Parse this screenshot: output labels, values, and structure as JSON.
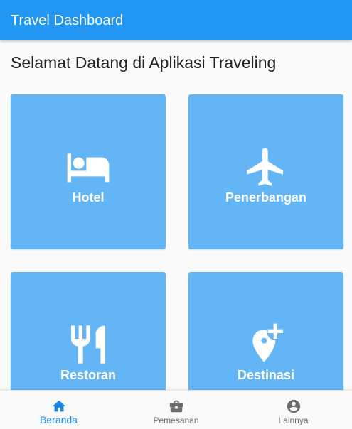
{
  "appbar": {
    "title": "Travel Dashboard"
  },
  "main": {
    "heading": "Selamat Datang di Aplikasi Traveling",
    "cards": [
      {
        "label": "Hotel",
        "icon": "hotel-bed-icon"
      },
      {
        "label": "Penerbangan",
        "icon": "airplane-icon"
      },
      {
        "label": "Restoran",
        "icon": "fork-knife-icon"
      },
      {
        "label": "Destinasi",
        "icon": "add-location-icon"
      }
    ],
    "card_color": "#64b5f6"
  },
  "bottom_nav": {
    "items": [
      {
        "label": "Beranda",
        "icon": "home-icon",
        "active": true
      },
      {
        "label": "Pemesanan",
        "icon": "briefcase-icon",
        "active": false
      },
      {
        "label": "Lainnya",
        "icon": "account-circle-icon",
        "active": false
      }
    ],
    "active_color": "#1e88e5",
    "inactive_color": "#6b6b6b"
  },
  "theme": {
    "primary": "#2196f3",
    "background": "#fafafa"
  }
}
